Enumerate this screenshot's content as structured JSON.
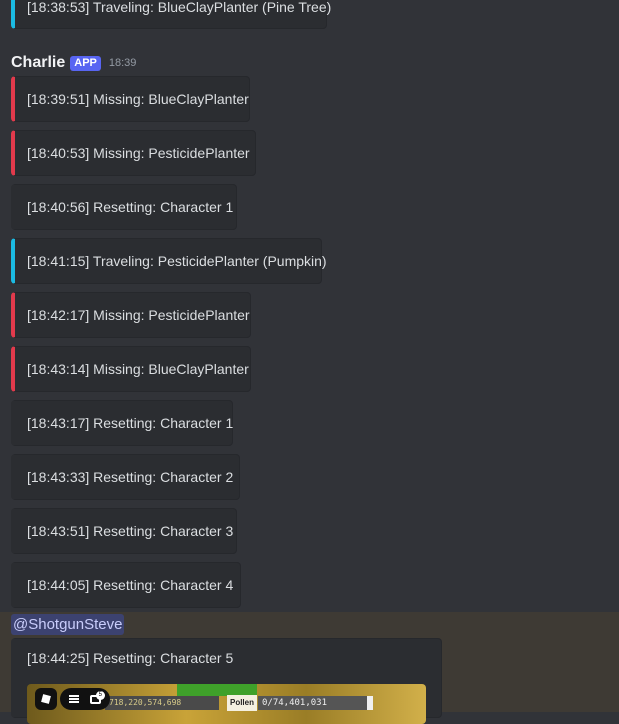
{
  "colors": {
    "background": "#313338",
    "embed_bg": "#2b2d31",
    "accent_blue": "#1bbbe3",
    "accent_red": "#e23a4c",
    "app_badge": "#5865f2",
    "mention_bg": "#3c4270"
  },
  "top_embed": {
    "text": "[18:38:53] Traveling: BlueClayPlanter (Pine Tree)",
    "color": "blue"
  },
  "message": {
    "author": "Charlie",
    "badge": "APP",
    "timestamp": "18:39",
    "embeds": [
      {
        "text": "[18:39:51] Missing: BlueClayPlanter",
        "color": "red"
      },
      {
        "text": "[18:40:53] Missing: PesticidePlanter",
        "color": "red"
      },
      {
        "text": "[18:40:56] Resetting: Character 1",
        "color": "grey"
      },
      {
        "text": "[18:41:15] Traveling: PesticidePlanter (Pumpkin)",
        "color": "blue"
      },
      {
        "text": "[18:42:17] Missing: PesticidePlanter",
        "color": "red"
      },
      {
        "text": "[18:43:14] Missing: BlueClayPlanter",
        "color": "red"
      },
      {
        "text": "[18:43:17] Resetting: Character 1",
        "color": "grey"
      },
      {
        "text": "[18:43:33] Resetting: Character 2",
        "color": "grey"
      },
      {
        "text": "[18:43:51] Resetting: Character 3",
        "color": "grey"
      },
      {
        "text": "[18:44:05] Resetting: Character 4",
        "color": "grey"
      }
    ]
  },
  "mention": "@ShotgunSteve",
  "last_embed": {
    "text": "[18:44:25] Resetting: Character 5",
    "image": {
      "stat_value": "718,220,574,698",
      "pollen_label": "Pollen",
      "pollen_value": "0/74,401,031",
      "chat_badge": "5"
    }
  }
}
